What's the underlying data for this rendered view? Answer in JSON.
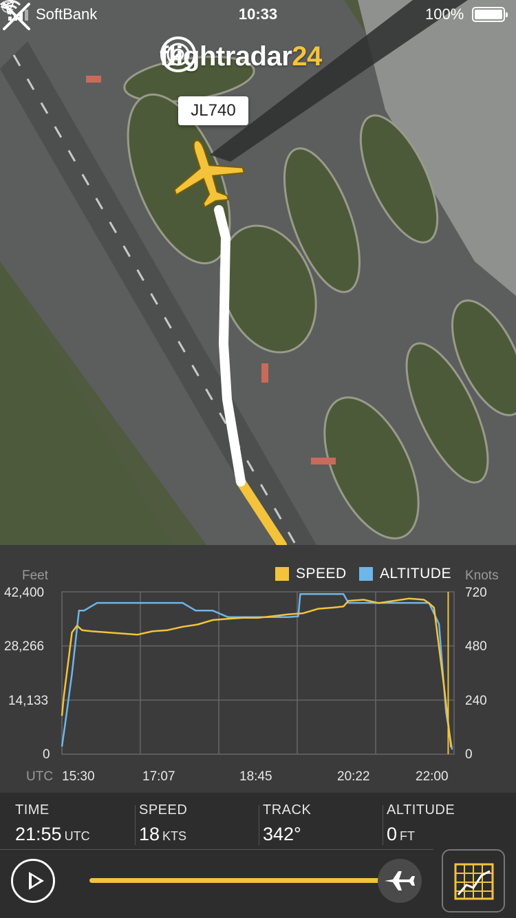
{
  "status_bar": {
    "carrier": "SoftBank",
    "time": "10:33",
    "battery": "100%"
  },
  "app": {
    "brand_main": "flightradar",
    "brand_num": "24",
    "flight_label": "JL740",
    "accent_color": "#f3c33b",
    "altitude_color": "#6db6ea"
  },
  "chart": {
    "left_unit": "Feet",
    "right_unit": "Knots",
    "legend_speed": "SPEED",
    "legend_altitude": "ALTITUDE",
    "y_left_ticks": [
      "42,400",
      "28,266",
      "14,133",
      "0"
    ],
    "y_right_ticks": [
      "720",
      "480",
      "240",
      "0"
    ],
    "x_prefix": "UTC",
    "x_ticks": [
      "15:30",
      "17:07",
      "18:45",
      "20:22",
      "22:00"
    ]
  },
  "chart_data": {
    "type": "line",
    "x_label": "UTC",
    "ylim_left": [
      0,
      42400
    ],
    "ylim_right": [
      0,
      720
    ],
    "series": [
      {
        "name": "ALTITUDE",
        "color": "#6db6ea",
        "axis": "left",
        "x": [
          "15:30",
          "15:33",
          "15:40",
          "15:47",
          "15:52",
          "16:05",
          "16:30",
          "17:00",
          "17:30",
          "17:43",
          "18:00",
          "18:15",
          "18:30",
          "18:45",
          "19:00",
          "19:15",
          "19:25",
          "19:27",
          "19:40",
          "19:55",
          "20:10",
          "20:15",
          "20:30",
          "20:45",
          "21:00",
          "21:15",
          "21:30",
          "21:35",
          "21:45",
          "21:52",
          "21:58"
        ],
        "values": [
          2000,
          7500,
          21000,
          37500,
          37500,
          39500,
          39500,
          39500,
          39500,
          37500,
          37500,
          35800,
          35800,
          35800,
          35800,
          35800,
          36000,
          41800,
          41800,
          41800,
          41800,
          39500,
          39500,
          39500,
          39500,
          39500,
          39500,
          39500,
          34000,
          11000,
          1200
        ]
      },
      {
        "name": "SPEED",
        "color": "#f3c33b",
        "axis": "right",
        "x": [
          "15:30",
          "15:32",
          "15:36",
          "15:40",
          "15:45",
          "15:50",
          "16:00",
          "16:15",
          "16:30",
          "16:45",
          "17:00",
          "17:15",
          "17:30",
          "17:45",
          "18:00",
          "18:15",
          "18:30",
          "18:45",
          "19:00",
          "19:15",
          "19:30",
          "19:45",
          "20:00",
          "20:10",
          "20:15",
          "20:30",
          "20:45",
          "21:00",
          "21:15",
          "21:30",
          "21:35",
          "21:40",
          "21:50",
          "21:57"
        ],
        "values": [
          170,
          260,
          400,
          540,
          570,
          550,
          545,
          540,
          535,
          530,
          545,
          550,
          565,
          575,
          595,
          600,
          605,
          605,
          612,
          620,
          625,
          645,
          650,
          655,
          680,
          685,
          670,
          680,
          690,
          685,
          670,
          650,
          300,
          30
        ]
      }
    ]
  },
  "stats": {
    "time_label": "TIME",
    "time_value": "21:55",
    "time_unit": "UTC",
    "speed_label": "SPEED",
    "speed_value": "18",
    "speed_unit": "KTS",
    "track_label": "TRACK",
    "track_value": "342°",
    "altitude_label": "ALTITUDE",
    "altitude_value": "0",
    "altitude_unit": "FT"
  },
  "playback": {
    "progress": 0.96
  },
  "icons": [
    "play-icon",
    "plane-knob-icon",
    "chart-toggle-icon",
    "close-icon",
    "logo-radar-icon",
    "wifi-icon",
    "moon-icon",
    "location-arrow-icon",
    "aircraft-icon"
  ]
}
